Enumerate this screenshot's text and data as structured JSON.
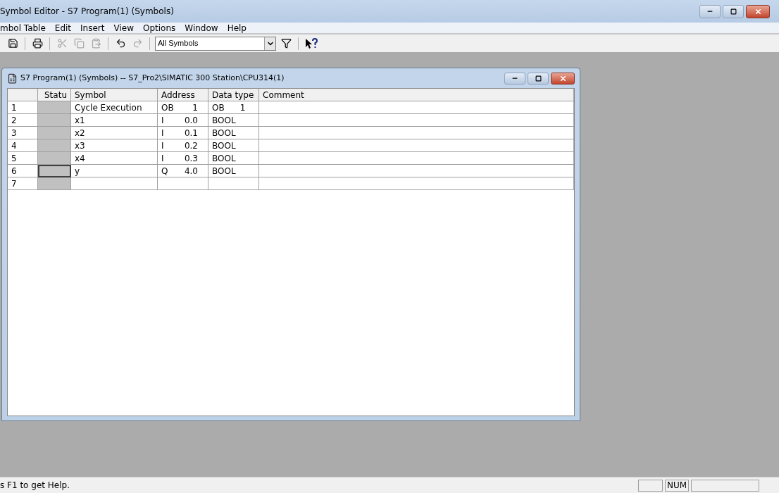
{
  "window": {
    "title": "Symbol Editor - S7 Program(1) (Symbols)"
  },
  "menu": [
    "mbol Table",
    "Edit",
    "Insert",
    "View",
    "Options",
    "Window",
    "Help"
  ],
  "toolbar": [
    {
      "kind": "save",
      "disabled": false
    },
    {
      "kind": "print",
      "disabled": false
    },
    {
      "kind": "cut",
      "disabled": true
    },
    {
      "kind": "copy",
      "disabled": true
    },
    {
      "kind": "paste",
      "disabled": true
    },
    {
      "kind": "undo",
      "disabled": false
    },
    {
      "kind": "redo",
      "disabled": true
    }
  ],
  "filter": {
    "value": "All Symbols"
  },
  "child_window": {
    "title": "S7 Program(1) (Symbols) -- S7_Pro2\\SIMATIC 300 Station\\CPU314(1)"
  },
  "table": {
    "columns": [
      "Statu",
      "Symbol",
      "Address",
      "Data type",
      "Comment"
    ],
    "rows": [
      {
        "number": "1",
        "selected": false,
        "symbol": "Cycle Execution",
        "address_area": "OB",
        "address_number": "1",
        "data_type": "OB",
        "data_type_number": "1"
      },
      {
        "number": "2",
        "selected": false,
        "symbol": "x1",
        "address_area": "I",
        "address_number": "0.0",
        "data_type": "BOOL"
      },
      {
        "number": "3",
        "selected": false,
        "symbol": "x2",
        "address_area": "I",
        "address_number": "0.1",
        "data_type": "BOOL"
      },
      {
        "number": "4",
        "selected": false,
        "symbol": "x3",
        "address_area": "I",
        "address_number": "0.2",
        "data_type": "BOOL"
      },
      {
        "number": "5",
        "selected": false,
        "symbol": "x4",
        "address_area": "I",
        "address_number": "0.3",
        "data_type": "BOOL"
      },
      {
        "number": "6",
        "selected": true,
        "symbol": "y",
        "address_area": "Q",
        "address_number": "4.0",
        "data_type": "BOOL"
      },
      {
        "number": "7",
        "selected": false
      }
    ]
  },
  "status_bar": {
    "message": "s F1 to get Help.",
    "indicator": "NUM"
  }
}
